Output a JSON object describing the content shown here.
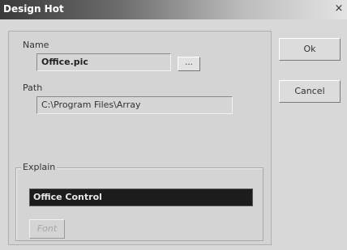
{
  "window": {
    "title": "Design Hot",
    "close_glyph": "×"
  },
  "form": {
    "name_label": "Name",
    "name_value": "Office.pic",
    "browse_label": "...",
    "path_label": "Path",
    "path_value": "C:\\Program Files\\Array",
    "explain_label": "Explain",
    "explain_value": "Office  Control",
    "font_button_label": "Font"
  },
  "buttons": {
    "ok_label": "Ok",
    "cancel_label": "Cancel"
  },
  "icons": {
    "close": "close-icon"
  },
  "colors": {
    "titlebar_dark": "#3a3a3a",
    "dialog_bg": "#d8d8d8",
    "explain_bg": "#1c1c1c",
    "explain_text": "#e6e6e6"
  }
}
